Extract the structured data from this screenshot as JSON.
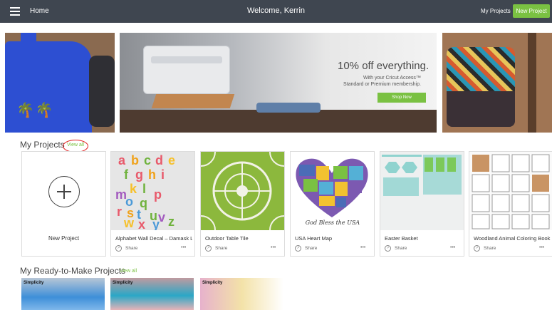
{
  "topbar": {
    "home": "Home",
    "welcome": "Welcome, Kerrin",
    "my_projects": "My Projects",
    "new_project": "New Project"
  },
  "banner": {
    "title": "10% off everything.",
    "sub1": "With your Cricut Access™",
    "sub2": "Standard or Premium membership.",
    "shop_now": "Shop Now"
  },
  "my_projects": {
    "title": "My Projects",
    "view_all": "View all",
    "new_project": "New Project",
    "cards": [
      {
        "title": "Alphabet Wall Decal – Damask L",
        "share": "Share",
        "more": "•••"
      },
      {
        "title": "Outdoor Table Tile",
        "share": "Share",
        "more": "•••"
      },
      {
        "title": "USA Heart Map",
        "share": "Share",
        "more": "•••"
      },
      {
        "title": "Easter Basket",
        "share": "Share",
        "more": "•••"
      },
      {
        "title": "Woodland Animal Coloring Book",
        "share": "Share",
        "more": "•••"
      }
    ]
  },
  "ready_to_make": {
    "title": "My Ready-to-Make Projects",
    "view_all": "View all",
    "labels": [
      "Simplicity",
      "Simplicity",
      "Simplicity"
    ]
  },
  "thumb_text": {
    "alphabet": [
      "a",
      "b",
      "c",
      "d",
      "e",
      "f",
      "g",
      "h",
      "i",
      "k",
      "l",
      "m",
      "o",
      "p",
      "q",
      "r",
      "s",
      "t",
      "u",
      "v",
      "w",
      "x",
      "y",
      "z"
    ],
    "map_caption": "God Bless the USA"
  },
  "colors": {
    "topbar": "#3f4650",
    "accent": "#7ac142",
    "highlight_circle": "#e02020"
  }
}
